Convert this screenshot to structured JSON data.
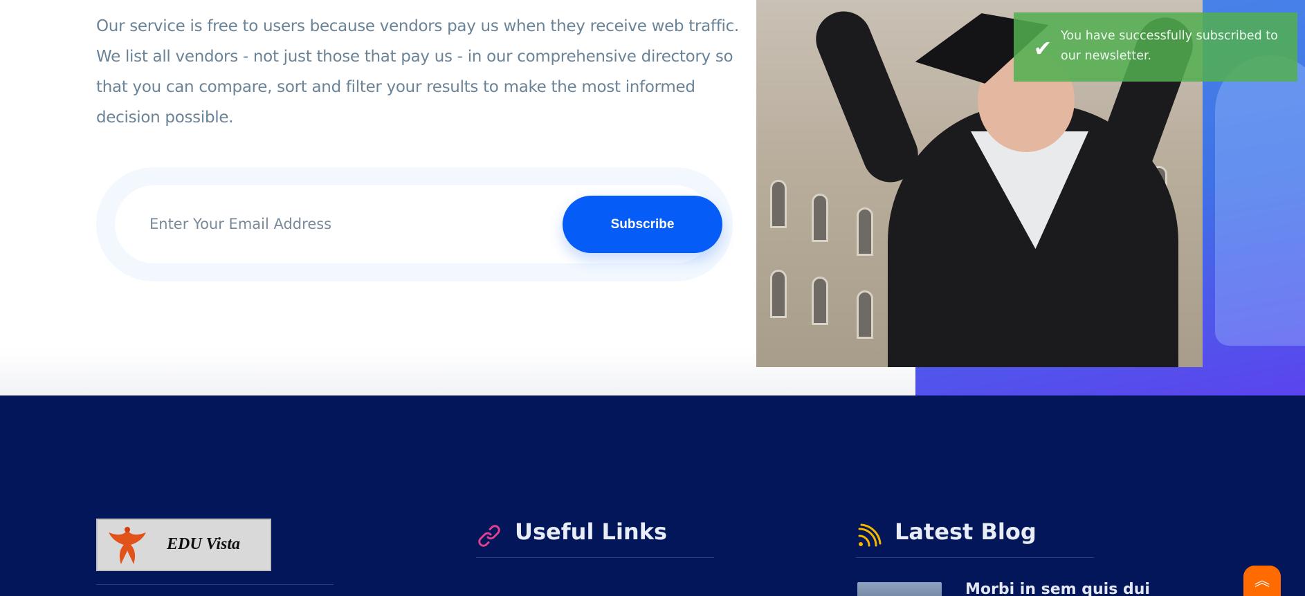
{
  "newsletter": {
    "intro_lines": [
      "Our service is free to users because vendors pay us when they receive web traffic.",
      "We list all vendors - not just those that pay us - in our comprehensive directory so",
      "that you can compare, sort and filter your results to make the most informed",
      "decision possible."
    ],
    "email_placeholder": "Enter Your Email Address",
    "subscribe_label": "Subscribe"
  },
  "toast": {
    "message": "You have successfully subscribed to our newsletter.",
    "icon": "check-icon",
    "color": "#53af50"
  },
  "footer": {
    "logo_text": "EDU Vista",
    "useful_links_heading": "Useful Links",
    "useful_links_icon": "link-icon",
    "latest_blog_heading": "Latest Blog",
    "latest_blog_icon": "rss-icon",
    "blog_posts": [
      {
        "title": "Morbi in sem quis dui"
      }
    ],
    "scroll_top_icon": "double-chevron-up-icon",
    "background_color": "#021659",
    "accent_color": "#ff6b00"
  },
  "colors": {
    "primary_button": "#055cf7",
    "body_text": "#6b8397"
  }
}
